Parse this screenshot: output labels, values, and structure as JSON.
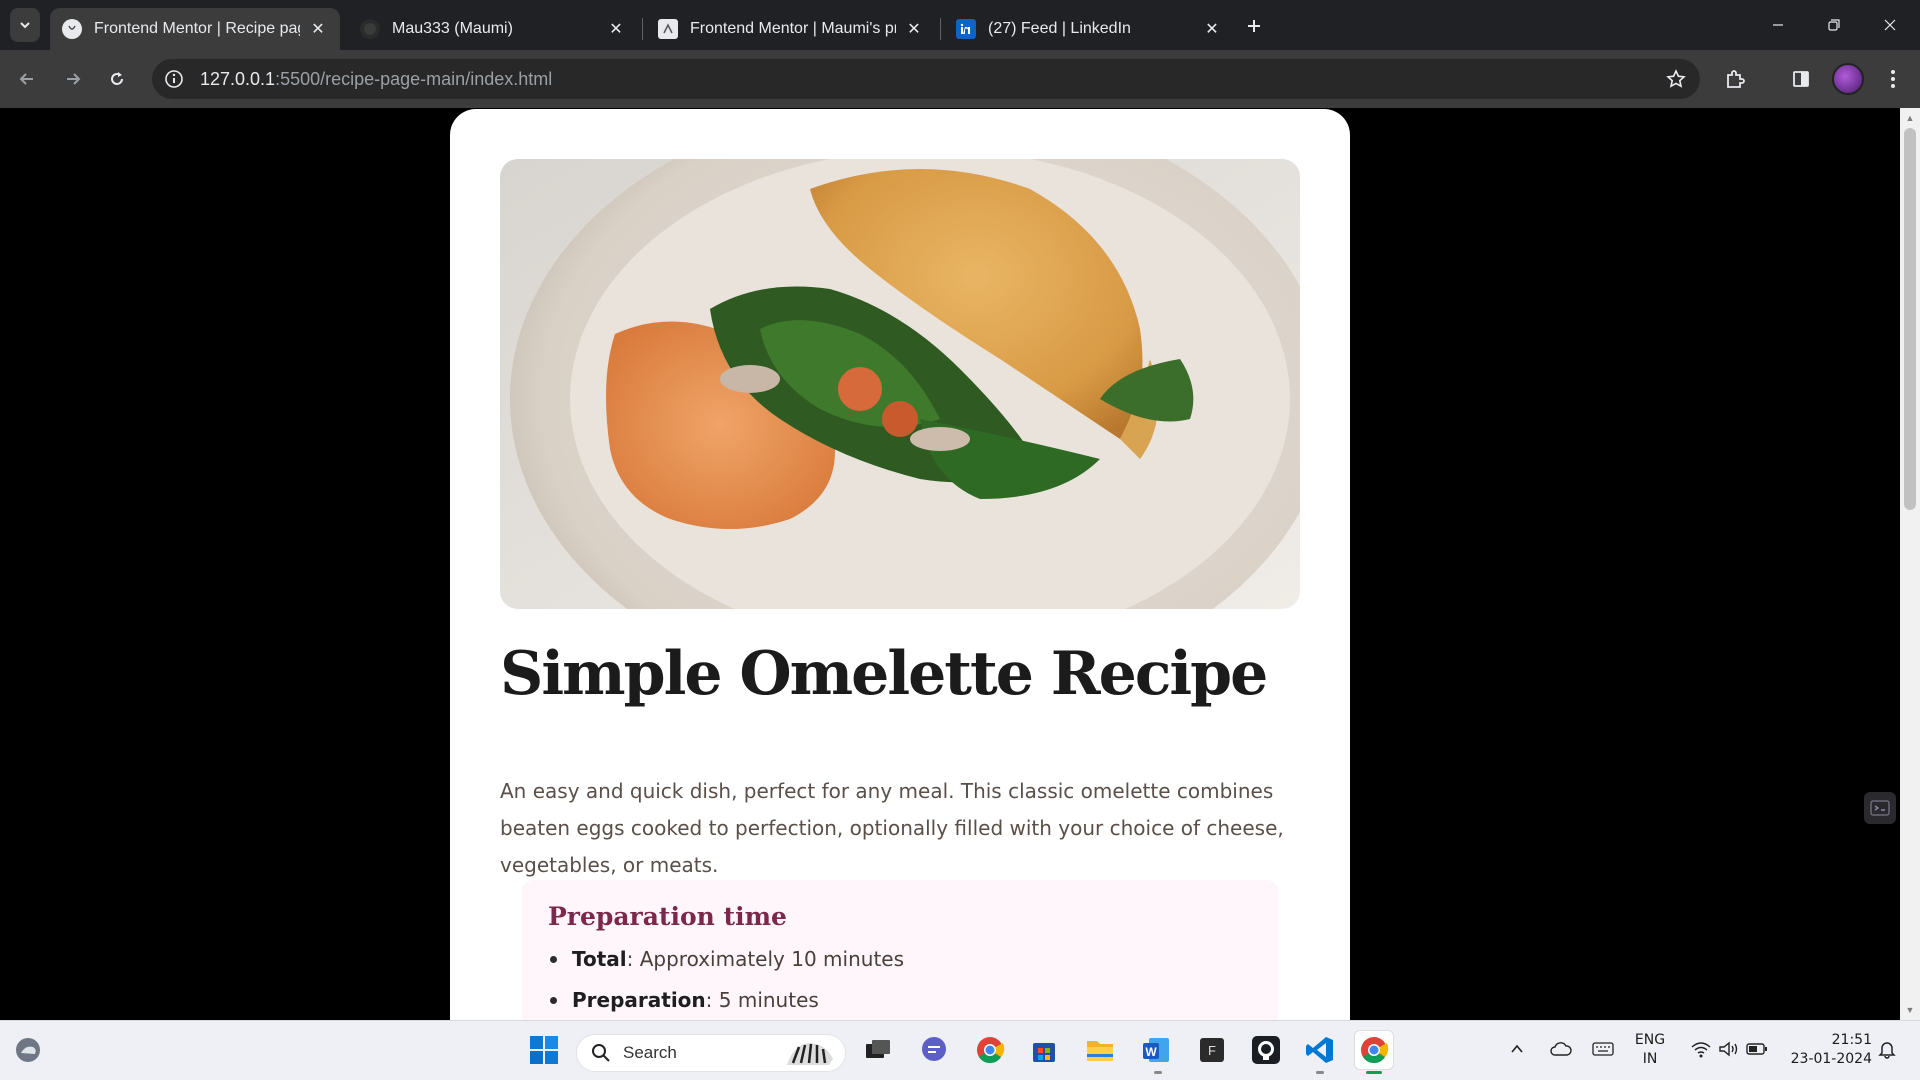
{
  "browser": {
    "tabs": [
      {
        "title": "Frontend Mentor | Recipe page",
        "active": true
      },
      {
        "title": "Mau333 (Maumi)",
        "active": false
      },
      {
        "title": "Frontend Mentor | Maumi's pro",
        "active": false
      },
      {
        "title": "(27) Feed | LinkedIn",
        "active": false
      }
    ],
    "close_symbol": "✕",
    "url_host": "127.0.0.1",
    "url_path": ":5500/recipe-page-main/index.html"
  },
  "page": {
    "title": "Simple Omelette Recipe",
    "description": "An easy and quick dish, perfect for any meal. This classic omelette combines beaten eggs cooked to perfection, optionally filled with your choice of cheese, vegetables, or meats.",
    "preparation": {
      "heading": "Preparation time",
      "items": [
        {
          "label": "Total",
          "value": ": Approximately 10 minutes"
        },
        {
          "label": "Preparation",
          "value": ": 5 minutes"
        }
      ]
    },
    "hero_image": "omelette-photo"
  },
  "taskbar": {
    "search_placeholder": "Search",
    "language_top": "ENG",
    "language_bottom": "IN",
    "time": "21:51",
    "date": "23-01-2024"
  },
  "colors": {
    "card_bg": "#ffffff",
    "prep_bg": "#fff6fb",
    "prep_heading": "#7a284b",
    "browser_dark": "#202124"
  }
}
